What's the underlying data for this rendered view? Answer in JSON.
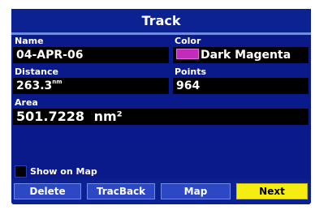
{
  "header": {
    "title": "Track"
  },
  "fields": {
    "name_label": "Name",
    "name_value": "04-APR-06",
    "color_label": "Color",
    "color_value": "Dark Magenta",
    "distance_label": "Distance",
    "distance_value": "263.3",
    "distance_unit": "nm",
    "points_label": "Points",
    "points_value": "964",
    "area_label": "Area",
    "area_value": "501.7228",
    "area_unit": "nm²"
  },
  "options": {
    "show_on_map_label": "Show on Map",
    "show_on_map_checked": false
  },
  "buttons": {
    "delete": "Delete",
    "trackback": "TracBack",
    "map": "Map",
    "next": "Next"
  },
  "colors": {
    "swatch": "#c22cbc",
    "active_button": "#f5ec12"
  }
}
